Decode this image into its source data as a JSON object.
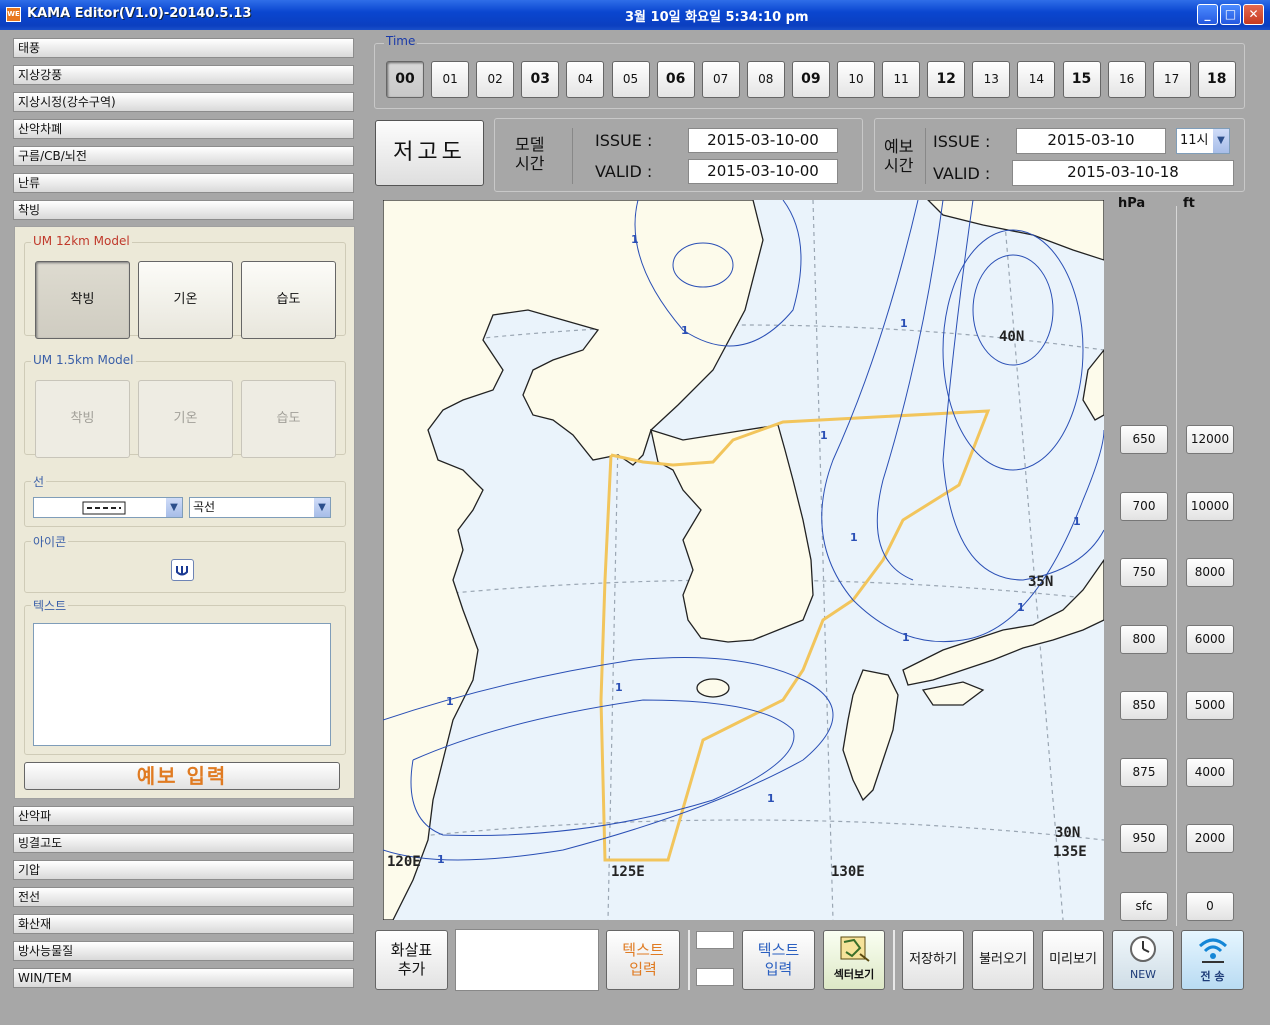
{
  "window": {
    "title": "KAMA Editor(V1.0)-20140.5.13",
    "clock": "3월 10일   화요일   5:34:10 pm",
    "icon_text": "WE",
    "minimize": "_",
    "maximize": "□",
    "close": "✕"
  },
  "left_menu_top": [
    "태풍",
    "지상강풍",
    "지상시정(강수구역)",
    "산악차폐",
    "구름/CB/뇌전",
    "난류",
    "착빙"
  ],
  "icing": {
    "um12_label": "UM 12km Model",
    "um12_buttons": [
      "착빙",
      "기온",
      "습도"
    ],
    "um15_label": "UM 1.5km Model",
    "um15_buttons": [
      "착빙",
      "기온",
      "습도"
    ],
    "line_label": "선",
    "line_type": "곡선",
    "icon_label": "아이콘",
    "text_label": "텍스트",
    "text_value": "",
    "forecast_input": "예보 입력"
  },
  "left_menu_bottom": [
    "산악파",
    "빙결고도",
    "기압",
    "전선",
    "화산재",
    "방사능물질",
    "WIN/TEM"
  ],
  "time": {
    "label": "Time",
    "hours": [
      {
        "text": "00",
        "bold": true,
        "selected": true
      },
      {
        "text": "01",
        "bold": false
      },
      {
        "text": "02",
        "bold": false
      },
      {
        "text": "03",
        "bold": true
      },
      {
        "text": "04",
        "bold": false
      },
      {
        "text": "05",
        "bold": false
      },
      {
        "text": "06",
        "bold": true
      },
      {
        "text": "07",
        "bold": false
      },
      {
        "text": "08",
        "bold": false
      },
      {
        "text": "09",
        "bold": true
      },
      {
        "text": "10",
        "bold": false
      },
      {
        "text": "11",
        "bold": false
      },
      {
        "text": "12",
        "bold": true
      },
      {
        "text": "13",
        "bold": false
      },
      {
        "text": "14",
        "bold": false
      },
      {
        "text": "15",
        "bold": true
      },
      {
        "text": "16",
        "bold": false
      },
      {
        "text": "17",
        "bold": false
      },
      {
        "text": "18",
        "bold": true
      }
    ]
  },
  "header": {
    "low_level_button": "저고도",
    "model_time_label": "모델\n시간",
    "model_issue_label": "ISSUE :",
    "model_issue": "2015-03-10-00",
    "model_valid_label": "VALID :",
    "model_valid": "2015-03-10-00",
    "forecast_time_label": "예보\n시간",
    "fc_issue_label": "ISSUE :",
    "fc_issue": "2015-03-10",
    "fc_hour": "11시",
    "fc_valid_label": "VALID :",
    "fc_valid": "2015-03-10-18"
  },
  "map": {
    "labels": {
      "lat40": "40N",
      "lat35": "35N",
      "lat30": "30N",
      "lon135": "135E",
      "lon120": "120E",
      "lon125": "125E",
      "lon130": "130E"
    },
    "contour_label": "1",
    "colors": {
      "sea": "#eaf3fb",
      "land": "#fdfbeb",
      "contour": "#2a4fb5",
      "fir": "#f2c55c",
      "grid": "#9aa6b3"
    }
  },
  "levels": {
    "hpa_label": "hPa",
    "ft_label": "ft",
    "hpa": [
      "650",
      "700",
      "750",
      "800",
      "850",
      "875",
      "950",
      "sfc"
    ],
    "ft": [
      "12000",
      "10000",
      "8000",
      "6000",
      "5000",
      "4000",
      "2000",
      "0"
    ]
  },
  "toolbar": {
    "arrow_add": "화살표\n추가",
    "text_input_orange": "텍스트\n입력",
    "text_input_blue": "텍스트\n입력",
    "sector_view": "섹터보기",
    "save": "저장하기",
    "load": "불러오기",
    "preview": "미리보기",
    "new": "NEW",
    "send": "전 송"
  }
}
